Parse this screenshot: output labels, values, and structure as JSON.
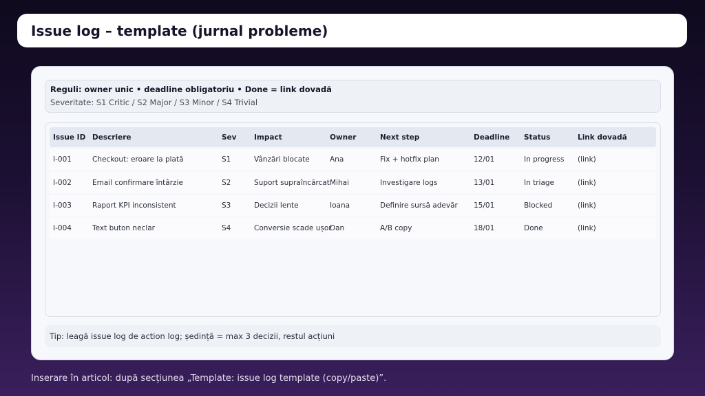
{
  "title": "Issue log – template (jurnal probleme)",
  "rules": {
    "line1": "Reguli: owner unic • deadline obligatoriu • Done = link dovadă",
    "line2": "Severitate: S1 Critic / S2 Major / S3 Minor / S4 Trivial"
  },
  "table": {
    "headers": [
      "Issue ID",
      "Descriere",
      "Sev",
      "Impact",
      "Owner",
      "Next step",
      "Deadline",
      "Status",
      "Link dovadă"
    ],
    "rows": [
      [
        "I-001",
        "Checkout: eroare la plată",
        "S1",
        "Vânzări blocate",
        "Ana",
        "Fix + hotfix plan",
        "12/01",
        "In progress",
        "(link)"
      ],
      [
        "I-002",
        "Email confirmare întârzie",
        "S2",
        "Suport supraîncărcat",
        "Mihai",
        "Investigare logs",
        "13/01",
        "In triage",
        "(link)"
      ],
      [
        "I-003",
        "Raport KPI inconsistent",
        "S3",
        "Decizii lente",
        "Ioana",
        "Definire sursă adevăr",
        "15/01",
        "Blocked",
        "(link)"
      ],
      [
        "I-004",
        "Text buton neclar",
        "S4",
        "Conversie scade ușor",
        "Dan",
        "A/B copy",
        "18/01",
        "Done",
        "(link)"
      ]
    ]
  },
  "tip": "Tip: leagă issue log de action log; ședință = max 3 decizii, restul acțiuni",
  "footer": "Inserare în articol: după secțiunea „Template: issue log template (copy/paste)”.",
  "colors": {
    "background_top": "#0f0a1e",
    "background_bottom": "#3a1f5c",
    "card": "#f7f8fb",
    "header_row": "#e4e8f0"
  }
}
